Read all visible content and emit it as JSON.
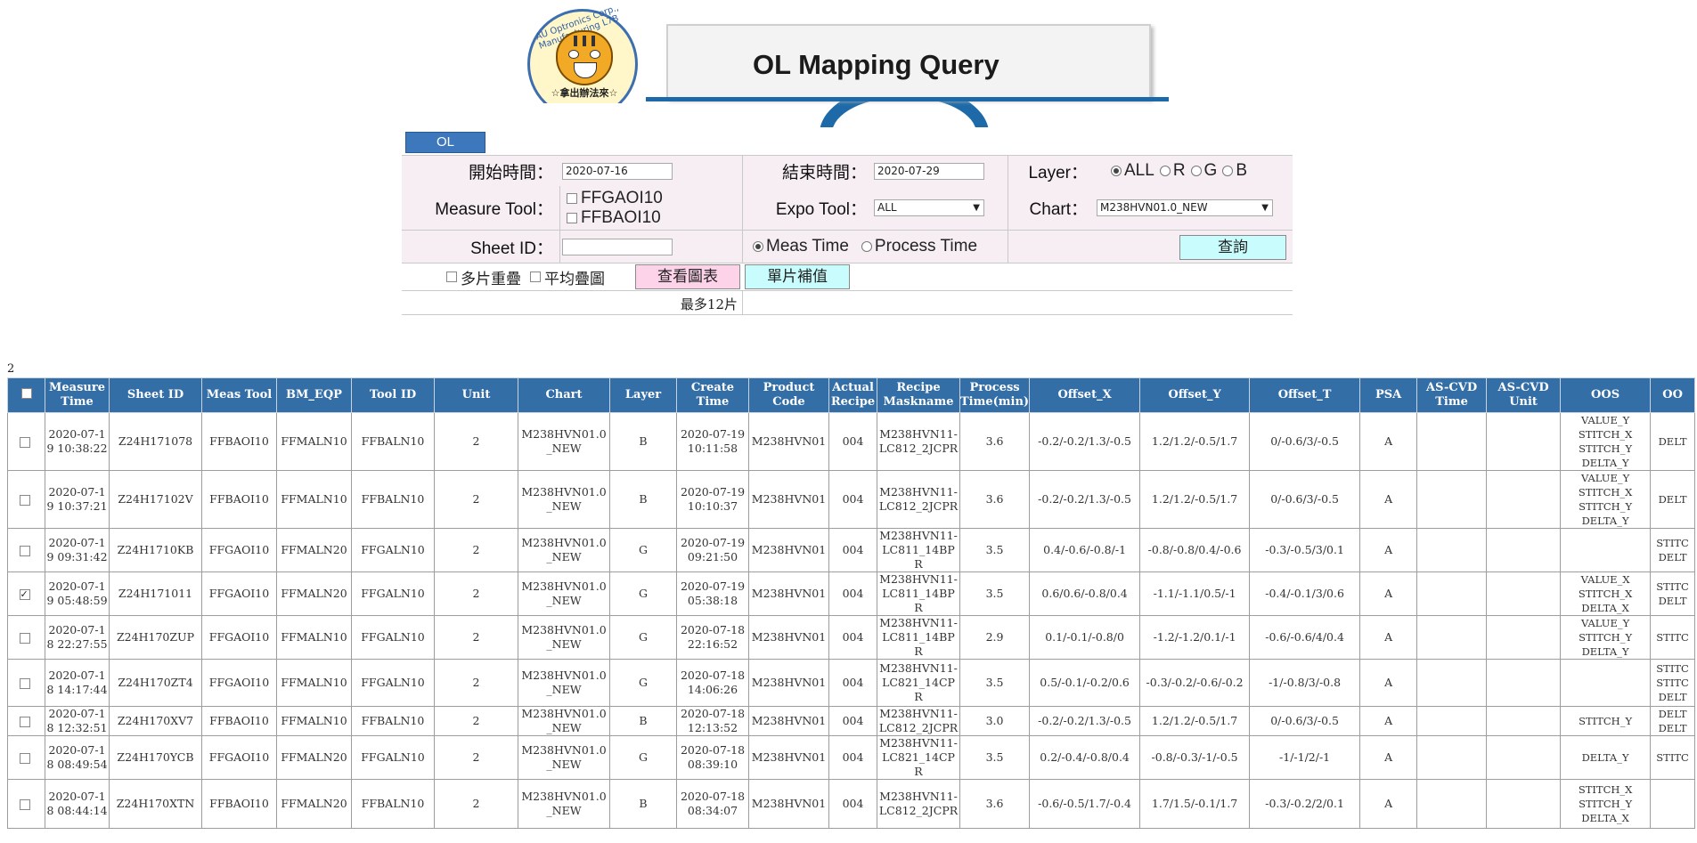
{
  "logo": {
    "ring_text": "AU Optronics Corp., Manufacturing L7B",
    "caption": "☆拿出辦法來☆"
  },
  "header": {
    "title": "OL Mapping Query"
  },
  "tab": {
    "label": "OL"
  },
  "form": {
    "start_label": "開始時間：",
    "start_value": "2020-07-16",
    "end_label": "結束時間：",
    "end_value": "2020-07-29",
    "layer_label": "Layer：",
    "layer_options": [
      "ALL",
      "R",
      "G",
      "B"
    ],
    "layer_selected": "ALL",
    "measure_tool_label": "Measure Tool：",
    "measure_tools": [
      "FFGAOI10",
      "FFBAOI10"
    ],
    "expo_tool_label": "Expo Tool：",
    "expo_tool_value": "ALL",
    "chart_label": "Chart：",
    "chart_value": "M238HVN01.0_NEW",
    "sheet_id_label": "Sheet ID：",
    "sheet_id_value": "",
    "time_options": [
      "Meas Time",
      "Process Time"
    ],
    "time_selected": "Meas Time",
    "query_button": "查詢",
    "multi_overlay": "多片重疊",
    "avg_overlay": "平均疊圖",
    "view_chart_button": "查看圖表",
    "single_fill_button": "單片補值",
    "max_note": "最多12片"
  },
  "results": {
    "count": "2",
    "columns": [
      "Measure Time",
      "Sheet ID",
      "Meas Tool",
      "BM_EQP",
      "Tool ID",
      "Unit",
      "Chart",
      "Layer",
      "Create Time",
      "Product Code",
      "Actual Recipe",
      "Recipe Maskname",
      "Process Time(min)",
      "Offset_X",
      "Offset_Y",
      "Offset_T",
      "PSA",
      "AS-CVD Time",
      "AS-CVD Unit",
      "OOS",
      "OO"
    ],
    "rows": [
      {
        "checked": false,
        "measure_time": "2020-07-19 10:38:22",
        "sheet_id": "Z24H171078",
        "meas_tool": "FFBAOI10",
        "bm_eqp": "FFMALN10",
        "tool_id": "FFBALN10",
        "unit": "2",
        "chart": "M238HVN01.0_NEW",
        "layer": "B",
        "create_time": "2020-07-19 10:11:58",
        "product_code": "M238HVN01",
        "actual_recipe": "004",
        "recipe_maskname": "M238HVN11-LC812_2JCPR",
        "process_time": "3.6",
        "offset_x": "-0.2/-0.2/1.3/-0.5",
        "offset_y": "1.2/1.2/-0.5/1.7",
        "offset_t": "0/-0.6/3/-0.5",
        "psa": "A",
        "oos": [
          "VALUE_Y",
          "STITCH_X",
          "STITCH_Y",
          "DELTA_Y"
        ],
        "oo": [
          "DELT"
        ]
      },
      {
        "checked": false,
        "measure_time": "2020-07-19 10:37:21",
        "sheet_id": "Z24H17102V",
        "meas_tool": "FFBAOI10",
        "bm_eqp": "FFMALN10",
        "tool_id": "FFBALN10",
        "unit": "2",
        "chart": "M238HVN01.0_NEW",
        "layer": "B",
        "create_time": "2020-07-19 10:10:37",
        "product_code": "M238HVN01",
        "actual_recipe": "004",
        "recipe_maskname": "M238HVN11-LC812_2JCPR",
        "process_time": "3.6",
        "offset_x": "-0.2/-0.2/1.3/-0.5",
        "offset_y": "1.2/1.2/-0.5/1.7",
        "offset_t": "0/-0.6/3/-0.5",
        "psa": "A",
        "oos": [
          "VALUE_Y",
          "STITCH_X",
          "STITCH_Y",
          "DELTA_Y"
        ],
        "oo": [
          "DELT"
        ]
      },
      {
        "checked": false,
        "measure_time": "2020-07-19 09:31:42",
        "sheet_id": "Z24H1710KB",
        "meas_tool": "FFGAOI10",
        "bm_eqp": "FFMALN20",
        "tool_id": "FFGALN10",
        "unit": "2",
        "chart": "M238HVN01.0_NEW",
        "layer": "G",
        "create_time": "2020-07-19 09:21:50",
        "product_code": "M238HVN01",
        "actual_recipe": "004",
        "recipe_maskname": "M238HVN11-LC811_14BPR",
        "process_time": "3.5",
        "offset_x": "0.4/-0.6/-0.8/-1",
        "offset_y": "-0.8/-0.8/0.4/-0.6",
        "offset_t": "-0.3/-0.5/3/0.1",
        "psa": "A",
        "oos": [],
        "oo": [
          "STITC",
          "DELT"
        ]
      },
      {
        "checked": true,
        "measure_time": "2020-07-19 05:48:59",
        "sheet_id": "Z24H171011",
        "meas_tool": "FFGAOI10",
        "bm_eqp": "FFMALN20",
        "tool_id": "FFGALN10",
        "unit": "2",
        "chart": "M238HVN01.0_NEW",
        "layer": "G",
        "create_time": "2020-07-19 05:38:18",
        "product_code": "M238HVN01",
        "actual_recipe": "004",
        "recipe_maskname": "M238HVN11-LC811_14BPR",
        "process_time": "3.5",
        "offset_x": "0.6/0.6/-0.8/0.4",
        "offset_y": "-1.1/-1.1/0.5/-1",
        "offset_t": "-0.4/-0.1/3/0.6",
        "psa": "A",
        "oos": [
          "VALUE_X",
          "STITCH_X",
          "DELTA_X"
        ],
        "oo": [
          "STITC",
          "DELT"
        ]
      },
      {
        "checked": false,
        "measure_time": "2020-07-18 22:27:55",
        "sheet_id": "Z24H170ZUP",
        "meas_tool": "FFGAOI10",
        "bm_eqp": "FFMALN10",
        "tool_id": "FFGALN10",
        "unit": "2",
        "chart": "M238HVN01.0_NEW",
        "layer": "G",
        "create_time": "2020-07-18 22:16:52",
        "product_code": "M238HVN01",
        "actual_recipe": "004",
        "recipe_maskname": "M238HVN11-LC811_14BPR",
        "process_time": "2.9",
        "offset_x": "0.1/-0.1/-0.8/0",
        "offset_y": "-1.2/-1.2/0.1/-1",
        "offset_t": "-0.6/-0.6/4/0.4",
        "psa": "A",
        "oos": [
          "VALUE_Y",
          "STITCH_Y",
          "DELTA_Y"
        ],
        "oo": [
          "STITC"
        ]
      },
      {
        "checked": false,
        "measure_time": "2020-07-18 14:17:44",
        "sheet_id": "Z24H170ZT4",
        "meas_tool": "FFGAOI10",
        "bm_eqp": "FFMALN10",
        "tool_id": "FFGALN10",
        "unit": "2",
        "chart": "M238HVN01.0_NEW",
        "layer": "G",
        "create_time": "2020-07-18 14:06:26",
        "product_code": "M238HVN01",
        "actual_recipe": "004",
        "recipe_maskname": "M238HVN11-LC821_14CPR",
        "process_time": "3.5",
        "offset_x": "0.5/-0.1/-0.2/0.6",
        "offset_y": "-0.3/-0.2/-0.6/-0.2",
        "offset_t": "-1/-0.8/3/-0.8",
        "psa": "A",
        "oos": [],
        "oo": [
          "STITC",
          "STITC",
          "DELT"
        ]
      },
      {
        "checked": false,
        "measure_time": "2020-07-18 12:32:51",
        "sheet_id": "Z24H170XV7",
        "meas_tool": "FFBAOI10",
        "bm_eqp": "FFMALN10",
        "tool_id": "FFBALN10",
        "unit": "2",
        "chart": "M238HVN01.0_NEW",
        "layer": "B",
        "create_time": "2020-07-18 12:13:52",
        "product_code": "M238HVN01",
        "actual_recipe": "004",
        "recipe_maskname": "M238HVN11-LC812_2JCPR",
        "process_time": "3.0",
        "offset_x": "-0.2/-0.2/1.3/-0.5",
        "offset_y": "1.2/1.2/-0.5/1.7",
        "offset_t": "0/-0.6/3/-0.5",
        "psa": "A",
        "oos": [
          "STITCH_Y"
        ],
        "oo": [
          "DELT",
          "DELT"
        ]
      },
      {
        "checked": false,
        "measure_time": "2020-07-18 08:49:54",
        "sheet_id": "Z24H170YCB",
        "meas_tool": "FFGAOI10",
        "bm_eqp": "FFMALN20",
        "tool_id": "FFGALN10",
        "unit": "2",
        "chart": "M238HVN01.0_NEW",
        "layer": "G",
        "create_time": "2020-07-18 08:39:10",
        "product_code": "M238HVN01",
        "actual_recipe": "004",
        "recipe_maskname": "M238HVN11-LC821_14CPR",
        "process_time": "3.5",
        "offset_x": "0.2/-0.4/-0.8/0.4",
        "offset_y": "-0.8/-0.3/-1/-0.5",
        "offset_t": "-1/-1/2/-1",
        "psa": "A",
        "oos": [
          "DELTA_Y"
        ],
        "oo": [
          "STITC"
        ]
      },
      {
        "checked": false,
        "measure_time": "2020-07-18 08:44:14",
        "sheet_id": "Z24H170XTN",
        "meas_tool": "FFBAOI10",
        "bm_eqp": "FFMALN20",
        "tool_id": "FFBALN10",
        "unit": "2",
        "chart": "M238HVN01.0_NEW",
        "layer": "B",
        "create_time": "2020-07-18 08:34:07",
        "product_code": "M238HVN01",
        "actual_recipe": "004",
        "recipe_maskname": "M238HVN11-LC812_2JCPR",
        "process_time": "3.6",
        "offset_x": "-0.6/-0.5/1.7/-0.4",
        "offset_y": "1.7/1.5/-0.1/1.7",
        "offset_t": "-0.3/-0.2/2/0.1",
        "psa": "A",
        "oos": [
          "STITCH_X",
          "STITCH_Y",
          "DELTA_X"
        ],
        "oo": []
      }
    ]
  }
}
